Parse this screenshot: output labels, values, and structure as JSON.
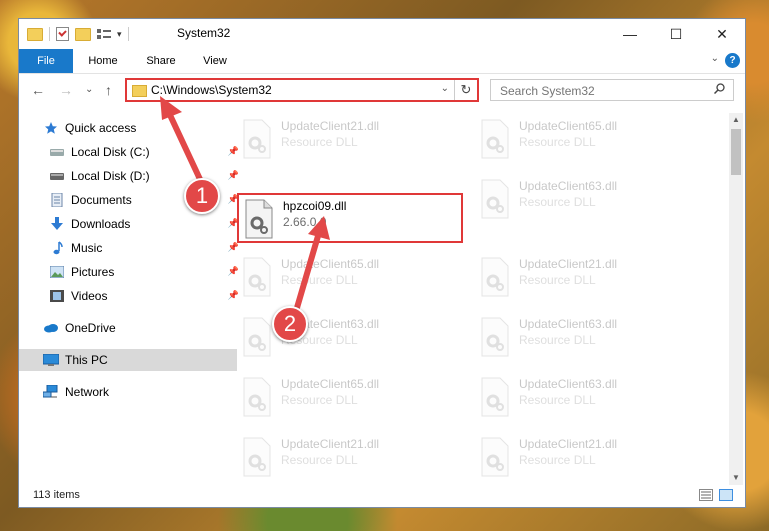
{
  "window": {
    "title": "System32",
    "controls": {
      "minimize": "—",
      "maximize": "☐",
      "close": "✕"
    }
  },
  "ribbon": {
    "tabs": [
      "File",
      "Home",
      "Share",
      "View"
    ],
    "help": "?"
  },
  "navigation": {
    "back": "←",
    "forward": "→",
    "recent": "⌄",
    "up": "↑",
    "address": "C:\\Windows\\System32",
    "search_placeholder": "Search System32"
  },
  "sidebar": {
    "items": [
      {
        "label": "Quick access",
        "icon": "star-icon",
        "pinned": false
      },
      {
        "label": "Local Disk (C:)",
        "icon": "drive-icon",
        "pinned": true
      },
      {
        "label": "Local Disk (D:)",
        "icon": "drive-icon",
        "pinned": true
      },
      {
        "label": "Documents",
        "icon": "documents-icon",
        "pinned": true
      },
      {
        "label": "Downloads",
        "icon": "downloads-icon",
        "pinned": true
      },
      {
        "label": "Music",
        "icon": "music-icon",
        "pinned": true
      },
      {
        "label": "Pictures",
        "icon": "pictures-icon",
        "pinned": true
      },
      {
        "label": "Videos",
        "icon": "videos-icon",
        "pinned": true
      },
      {
        "label": "OneDrive",
        "icon": "cloud-icon",
        "pinned": false
      },
      {
        "label": "This PC",
        "icon": "computer-icon",
        "pinned": false,
        "selected": true
      },
      {
        "label": "Network",
        "icon": "network-icon",
        "pinned": false
      }
    ]
  },
  "files": {
    "left": [
      {
        "name": "UpdateClient21.dll",
        "desc": "Resource DLL",
        "faded": true
      },
      {
        "name": "hpzcoi09.dll",
        "desc": "2.66.0.0",
        "faded": false,
        "highlight": true
      },
      {
        "name": "UpdateClient65.dll",
        "desc": "Resource DLL",
        "faded": true
      },
      {
        "name": "UpdateClient63.dll",
        "desc": "Resource DLL",
        "faded": true
      },
      {
        "name": "UpdateClient65.dll",
        "desc": "Resource DLL",
        "faded": true
      },
      {
        "name": "UpdateClient21.dll",
        "desc": "Resource DLL",
        "faded": true
      }
    ],
    "right": [
      {
        "name": "UpdateClient65.dll",
        "desc": "Resource DLL",
        "faded": true
      },
      {
        "name": "UpdateClient63.dll",
        "desc": "Resource DLL",
        "faded": true
      },
      {
        "name": "UpdateClient21.dll",
        "desc": "Resource DLL",
        "faded": true
      },
      {
        "name": "UpdateClient63.dll",
        "desc": "Resource DLL",
        "faded": true
      },
      {
        "name": "UpdateClient63.dll",
        "desc": "Resource DLL",
        "faded": true
      },
      {
        "name": "UpdateClient21.dll",
        "desc": "Resource DLL",
        "faded": true
      }
    ]
  },
  "status": {
    "count": "113 items"
  },
  "callouts": [
    "1",
    "2"
  ],
  "colors": {
    "accent": "#1979ca",
    "highlight": "#e03838",
    "selected": "#d9d9d9"
  }
}
